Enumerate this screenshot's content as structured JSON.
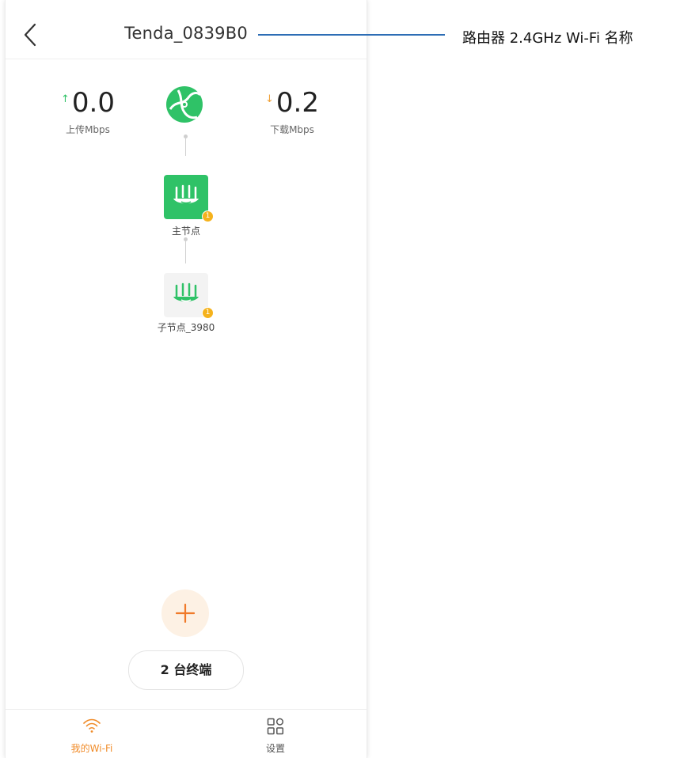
{
  "header": {
    "title": "Tenda_0839B0"
  },
  "stats": {
    "upload": {
      "value": "0.0",
      "label": "上传Mbps",
      "arrow": "↑"
    },
    "download": {
      "value": "0.2",
      "label": "下载Mbps",
      "arrow": "↓"
    }
  },
  "topology": {
    "main_node": {
      "label": "主节点",
      "badge": "1"
    },
    "sub_node": {
      "label": "子节点_3980",
      "badge": "1"
    }
  },
  "actions": {
    "terminals_label": "2 台终端"
  },
  "tabbar": {
    "tabs": [
      {
        "label": "我的Wi-Fi",
        "icon": "wifi-icon",
        "active": true
      },
      {
        "label": "设置",
        "icon": "grid-icon",
        "active": false
      }
    ]
  },
  "annotation": {
    "text": "路由器 2.4GHz Wi-Fi 名称"
  },
  "colors": {
    "accent_green": "#2fc267",
    "accent_orange": "#f08c2a",
    "badge_yellow": "#f5b21c",
    "callout_blue": "#2d6db5"
  }
}
